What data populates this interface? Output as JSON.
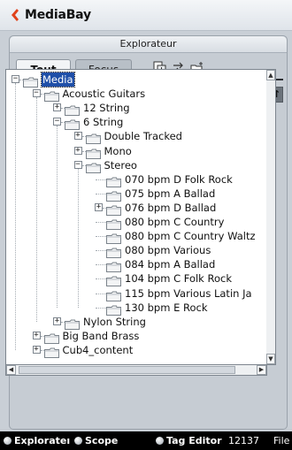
{
  "window": {
    "title": "MediaBay"
  },
  "panel": {
    "header": "Explorateur",
    "tabs": [
      {
        "label": "Tout"
      },
      {
        "label": "Focus"
      }
    ]
  },
  "nav": {
    "add": "+",
    "remove": "-",
    "dropdown": "▾"
  },
  "tree": [
    {
      "label": "Media",
      "depth": 0,
      "expander": "-",
      "selected": true
    },
    {
      "label": "Acoustic Guitars",
      "depth": 1,
      "expander": "-"
    },
    {
      "label": "12 String",
      "depth": 2,
      "expander": "+"
    },
    {
      "label": "6 String",
      "depth": 2,
      "expander": "-"
    },
    {
      "label": "Double Tracked",
      "depth": 3,
      "expander": "+"
    },
    {
      "label": "Mono",
      "depth": 3,
      "expander": "+"
    },
    {
      "label": "Stereo",
      "depth": 3,
      "expander": "-"
    },
    {
      "label": "070 bpm D Folk Rock",
      "depth": 4
    },
    {
      "label": "075 bpm A Ballad",
      "depth": 4
    },
    {
      "label": "076 bpm D Ballad",
      "depth": 4,
      "expander": "+"
    },
    {
      "label": "080 bpm C Country",
      "depth": 4
    },
    {
      "label": "080 bpm C Country Waltz",
      "depth": 4
    },
    {
      "label": "080 bpm Various",
      "depth": 4
    },
    {
      "label": "084 bpm A Ballad",
      "depth": 4
    },
    {
      "label": "104 bpm C Folk Rock",
      "depth": 4
    },
    {
      "label": "115 bpm Various Latin Ja",
      "depth": 4
    },
    {
      "label": "130 bpm E Rock",
      "depth": 4
    },
    {
      "label": "Nylon String",
      "depth": 2,
      "expander": "+"
    },
    {
      "label": "Big Band Brass",
      "depth": 1,
      "expander": "+"
    },
    {
      "label": "Cub4_content",
      "depth": 1,
      "expander": "+"
    }
  ],
  "status": {
    "explorer": "Explorateı",
    "scope": "Scope",
    "tag_editor": "Tag Editor",
    "count": "12137",
    "files_label": "File"
  },
  "colors": {
    "accent": "#1f4fa8",
    "logo": "#e0421b"
  }
}
